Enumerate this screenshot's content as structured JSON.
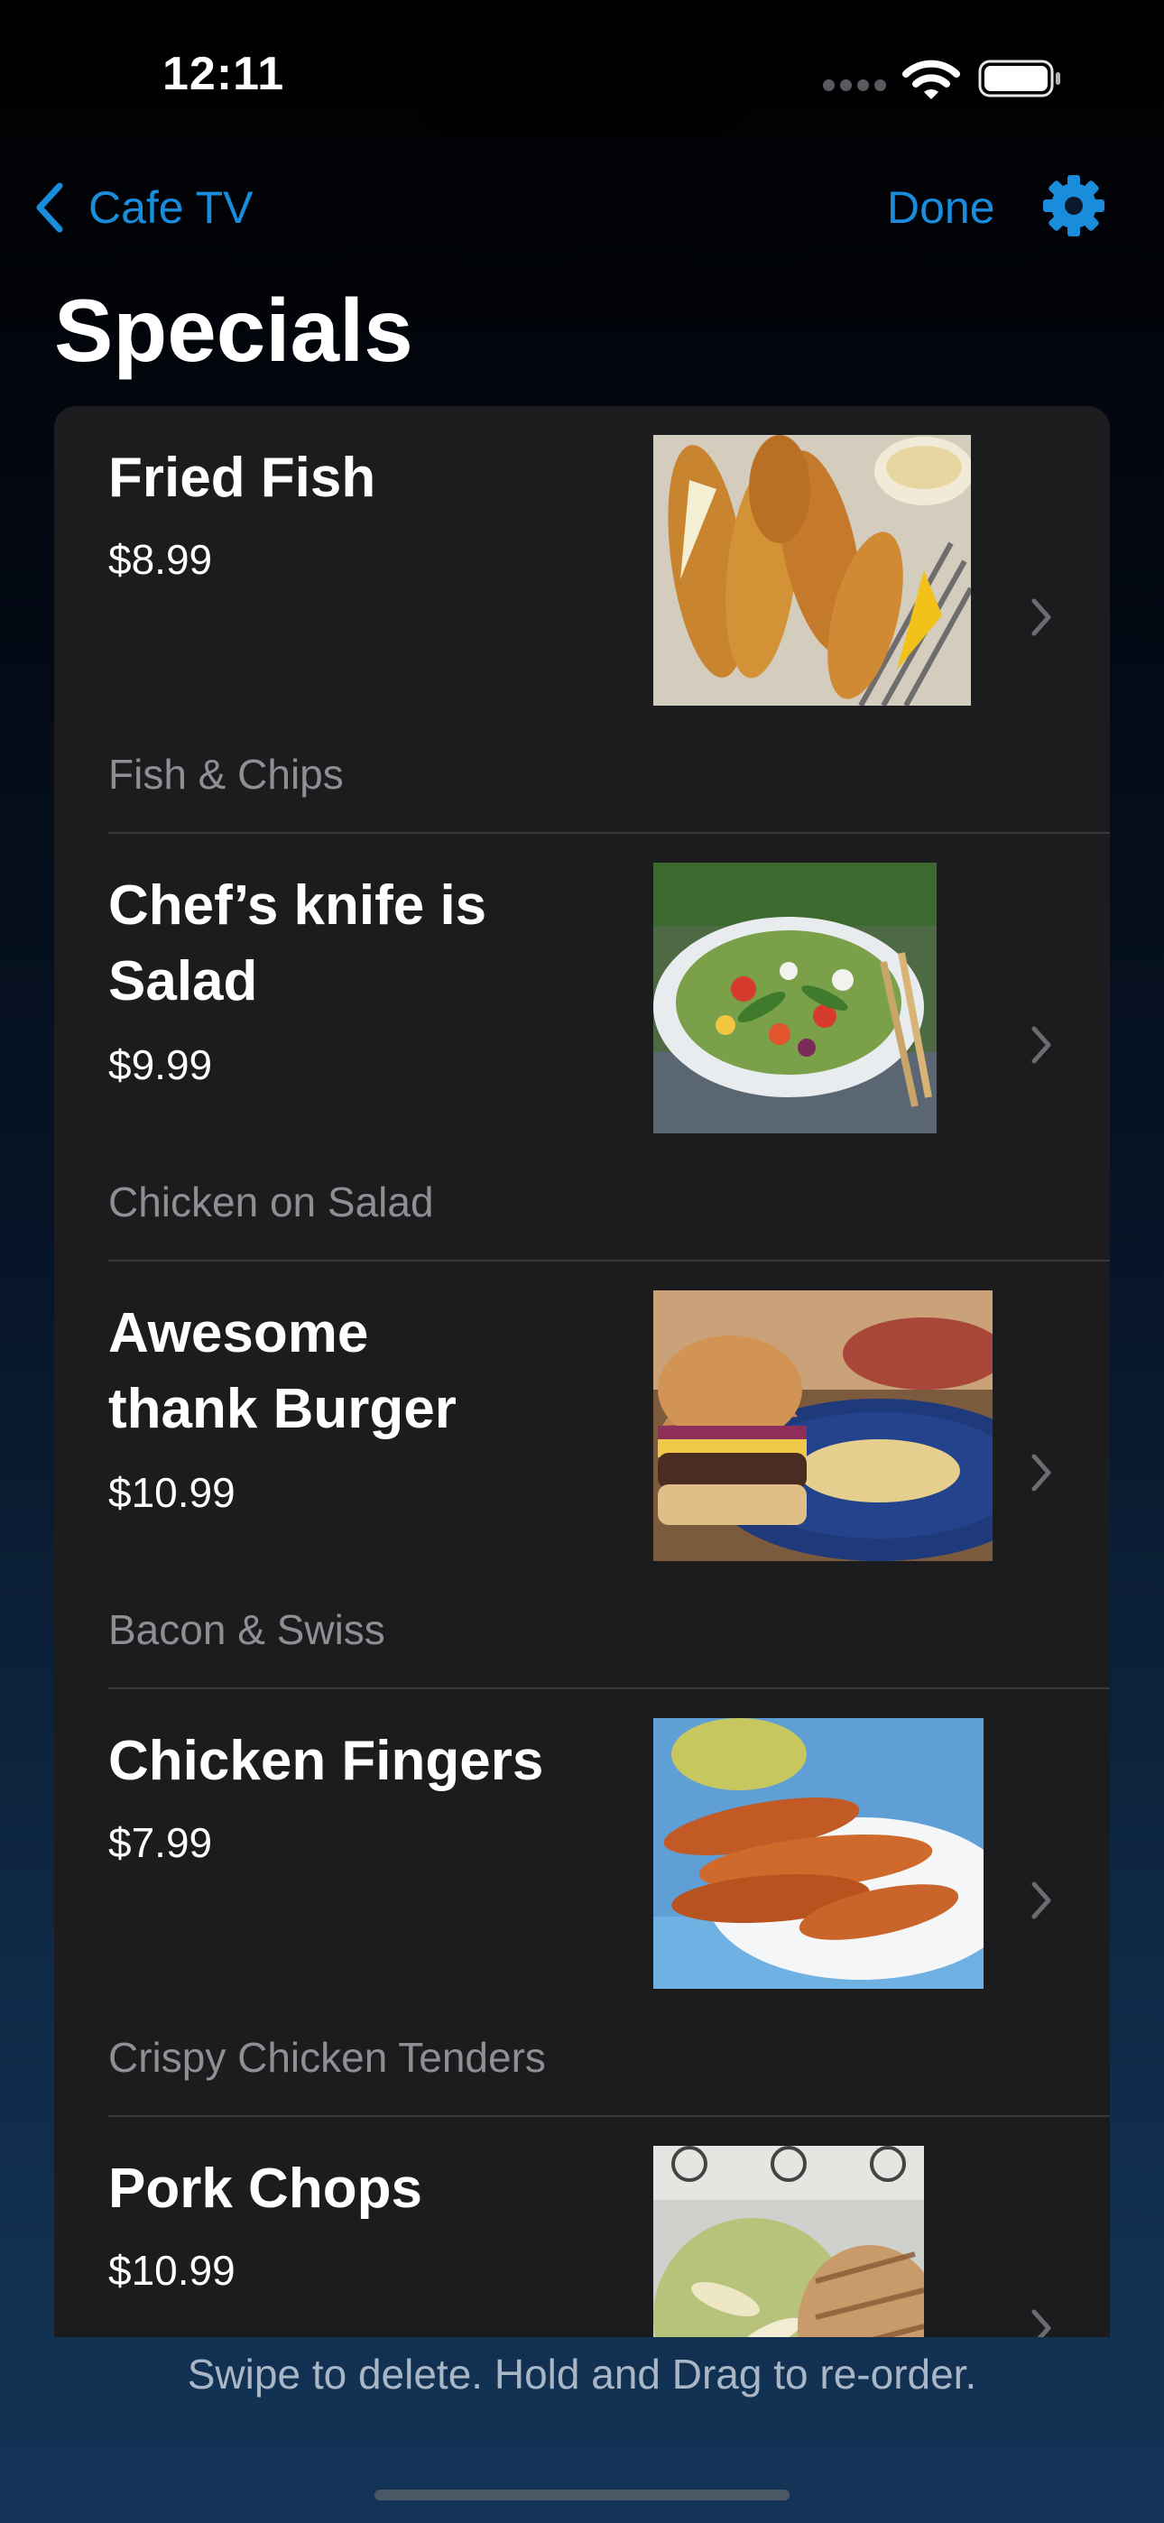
{
  "status_bar": {
    "time": "12:11"
  },
  "nav": {
    "back_label": "Cafe TV",
    "done_label": "Done"
  },
  "page": {
    "title": "Specials",
    "footer_hint": "Swipe to delete. Hold and Drag to re-order."
  },
  "colors": {
    "accent": "#1a8cdc",
    "card": "#1c1c1e",
    "secondary_text": "#8e8e93"
  },
  "icons": {
    "back": "chevron-left-icon",
    "settings": "gear-icon",
    "row_disclosure": "chevron-right-icon"
  },
  "items": [
    {
      "name": "Fried Fish",
      "price": "$8.99",
      "subtitle": "Fish & Chips",
      "image": "fried-fish-photo"
    },
    {
      "name": "Chef’s knife is Salad",
      "price": "$9.99",
      "subtitle": "Chicken on Salad",
      "image": "salad-photo"
    },
    {
      "name": "Awesome thank Burger",
      "price": "$10.99",
      "subtitle": "Bacon & Swiss",
      "image": "burger-photo"
    },
    {
      "name": "Chicken Fingers",
      "price": "$7.99",
      "subtitle": "Crispy Chicken Tenders",
      "image": "chicken-fingers-photo"
    },
    {
      "name": "Pork Chops",
      "price": "$10.99",
      "subtitle": "",
      "image": "pork-chops-photo"
    }
  ]
}
